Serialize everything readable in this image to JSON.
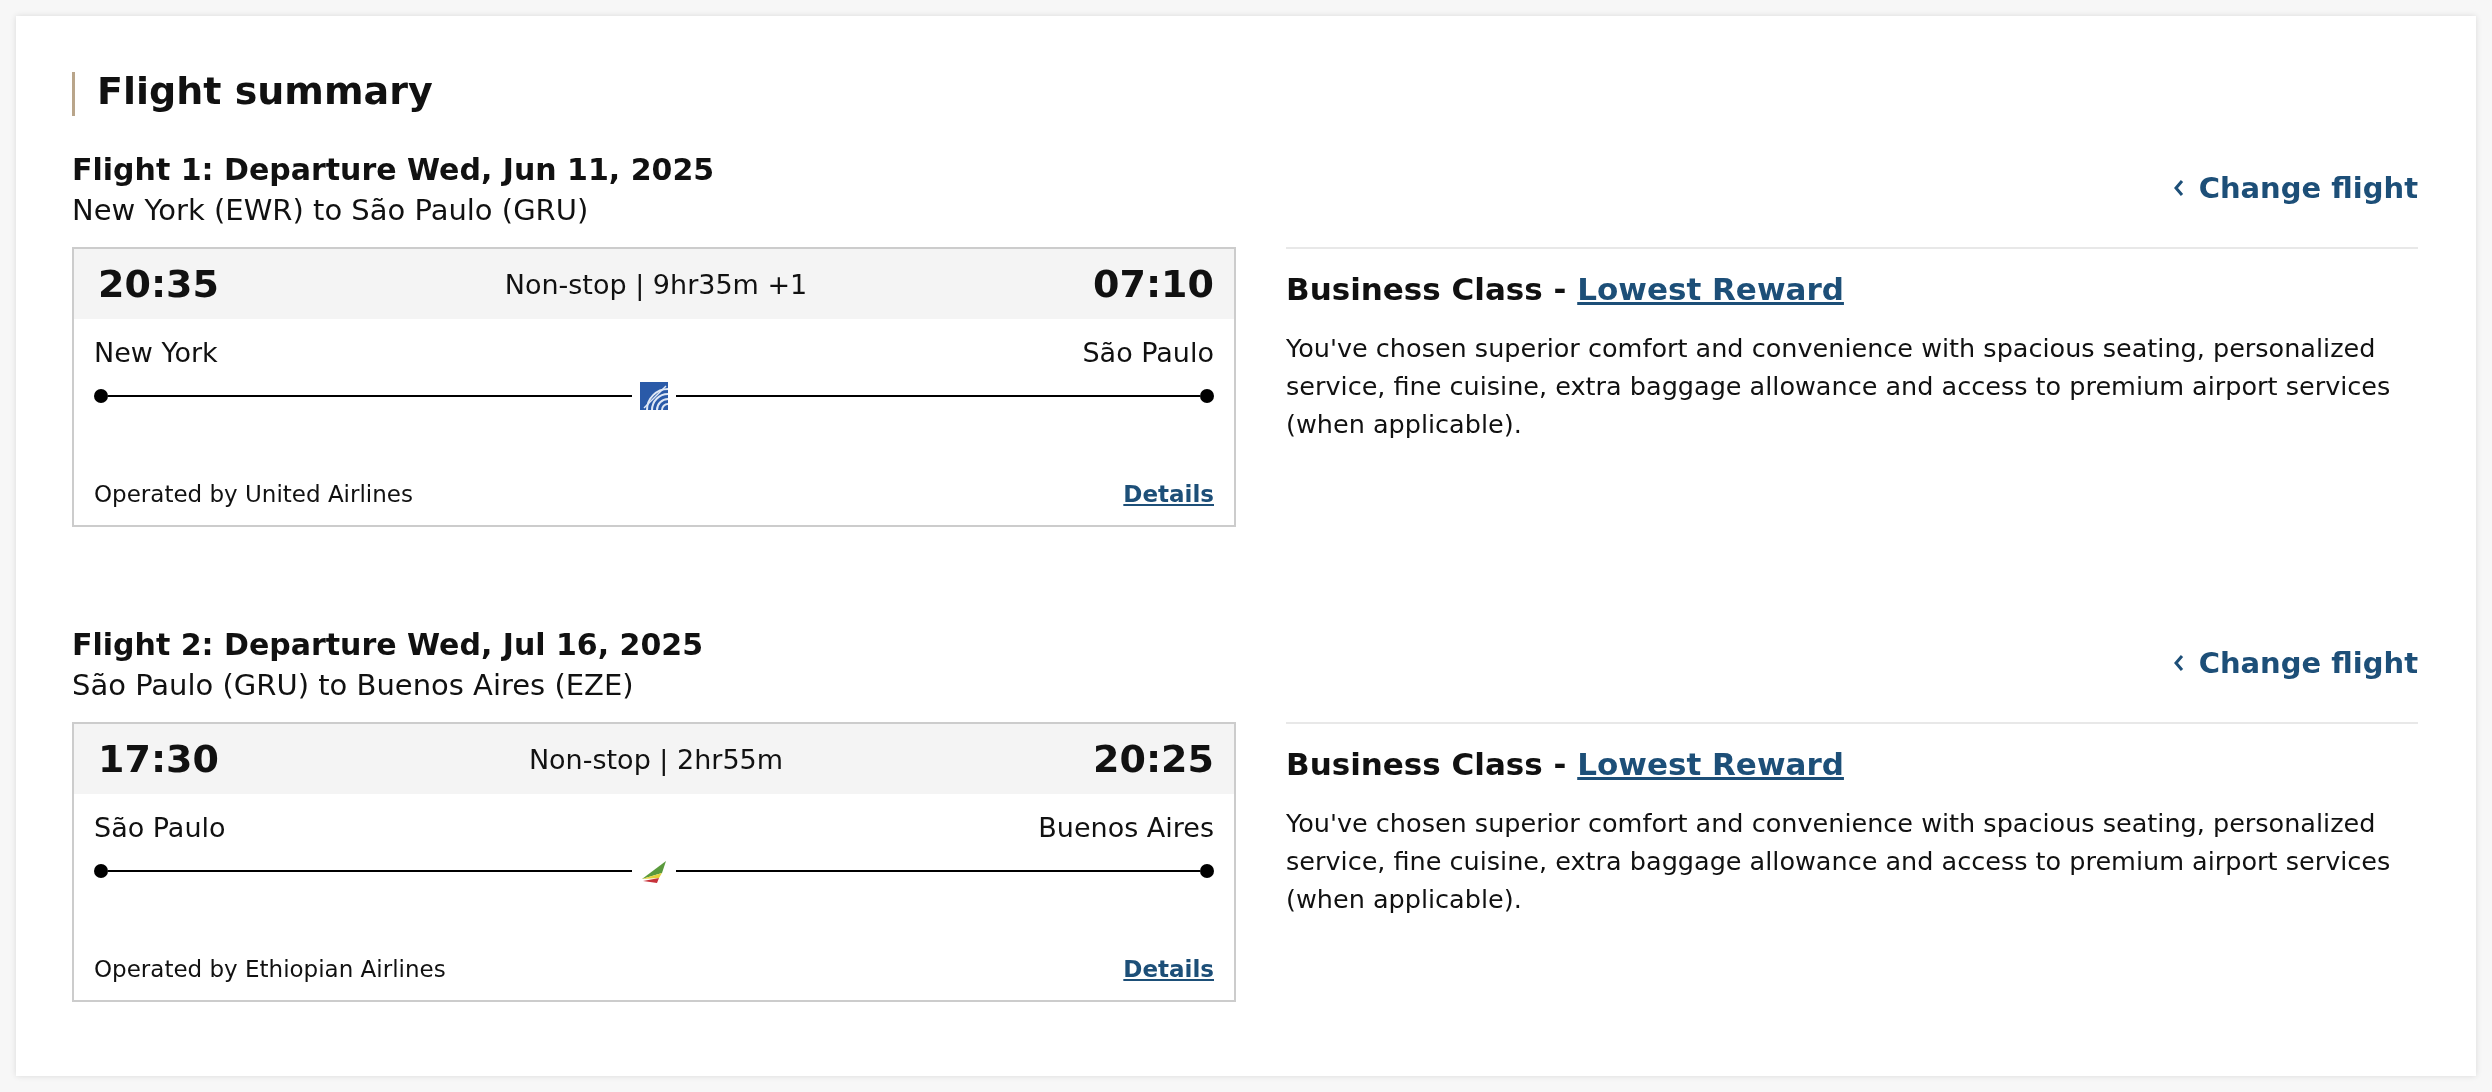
{
  "title": "Flight summary",
  "flights": [
    {
      "heading": "Flight 1: Departure Wed, Jun 11, 2025",
      "route": "New York (EWR) to São Paulo (GRU)",
      "depart_time": "20:35",
      "summary": "Non-stop | 9hr35m +1",
      "arrive_time": "07:10",
      "origin": "New York",
      "destination": "São Paulo",
      "logo": {
        "kind": "globe"
      },
      "operator": "Operated by United Airlines",
      "details_link": "Details",
      "change_link": "Change flight",
      "cabin": "Business Class - ",
      "fare_link": "Lowest Reward",
      "description": "You've chosen superior comfort and convenience with spacious seating, personalized service, fine cuisine, extra baggage allowance and access to premium airport services (when applicable)."
    },
    {
      "heading": "Flight 2: Departure Wed, Jul 16, 2025",
      "route": "São Paulo (GRU) to Buenos Aires (EZE)",
      "depart_time": "17:30",
      "summary": "Non-stop | 2hr55m",
      "arrive_time": "20:25",
      "origin": "São Paulo",
      "destination": "Buenos Aires",
      "logo": {
        "kind": "tail"
      },
      "operator": "Operated by Ethiopian Airlines",
      "details_link": "Details",
      "change_link": "Change flight",
      "cabin": "Business Class - ",
      "fare_link": "Lowest Reward",
      "description": "You've chosen superior comfort and convenience with spacious seating, personalized service, fine cuisine, extra baggage allowance and access to premium airport services (when applicable)."
    }
  ]
}
